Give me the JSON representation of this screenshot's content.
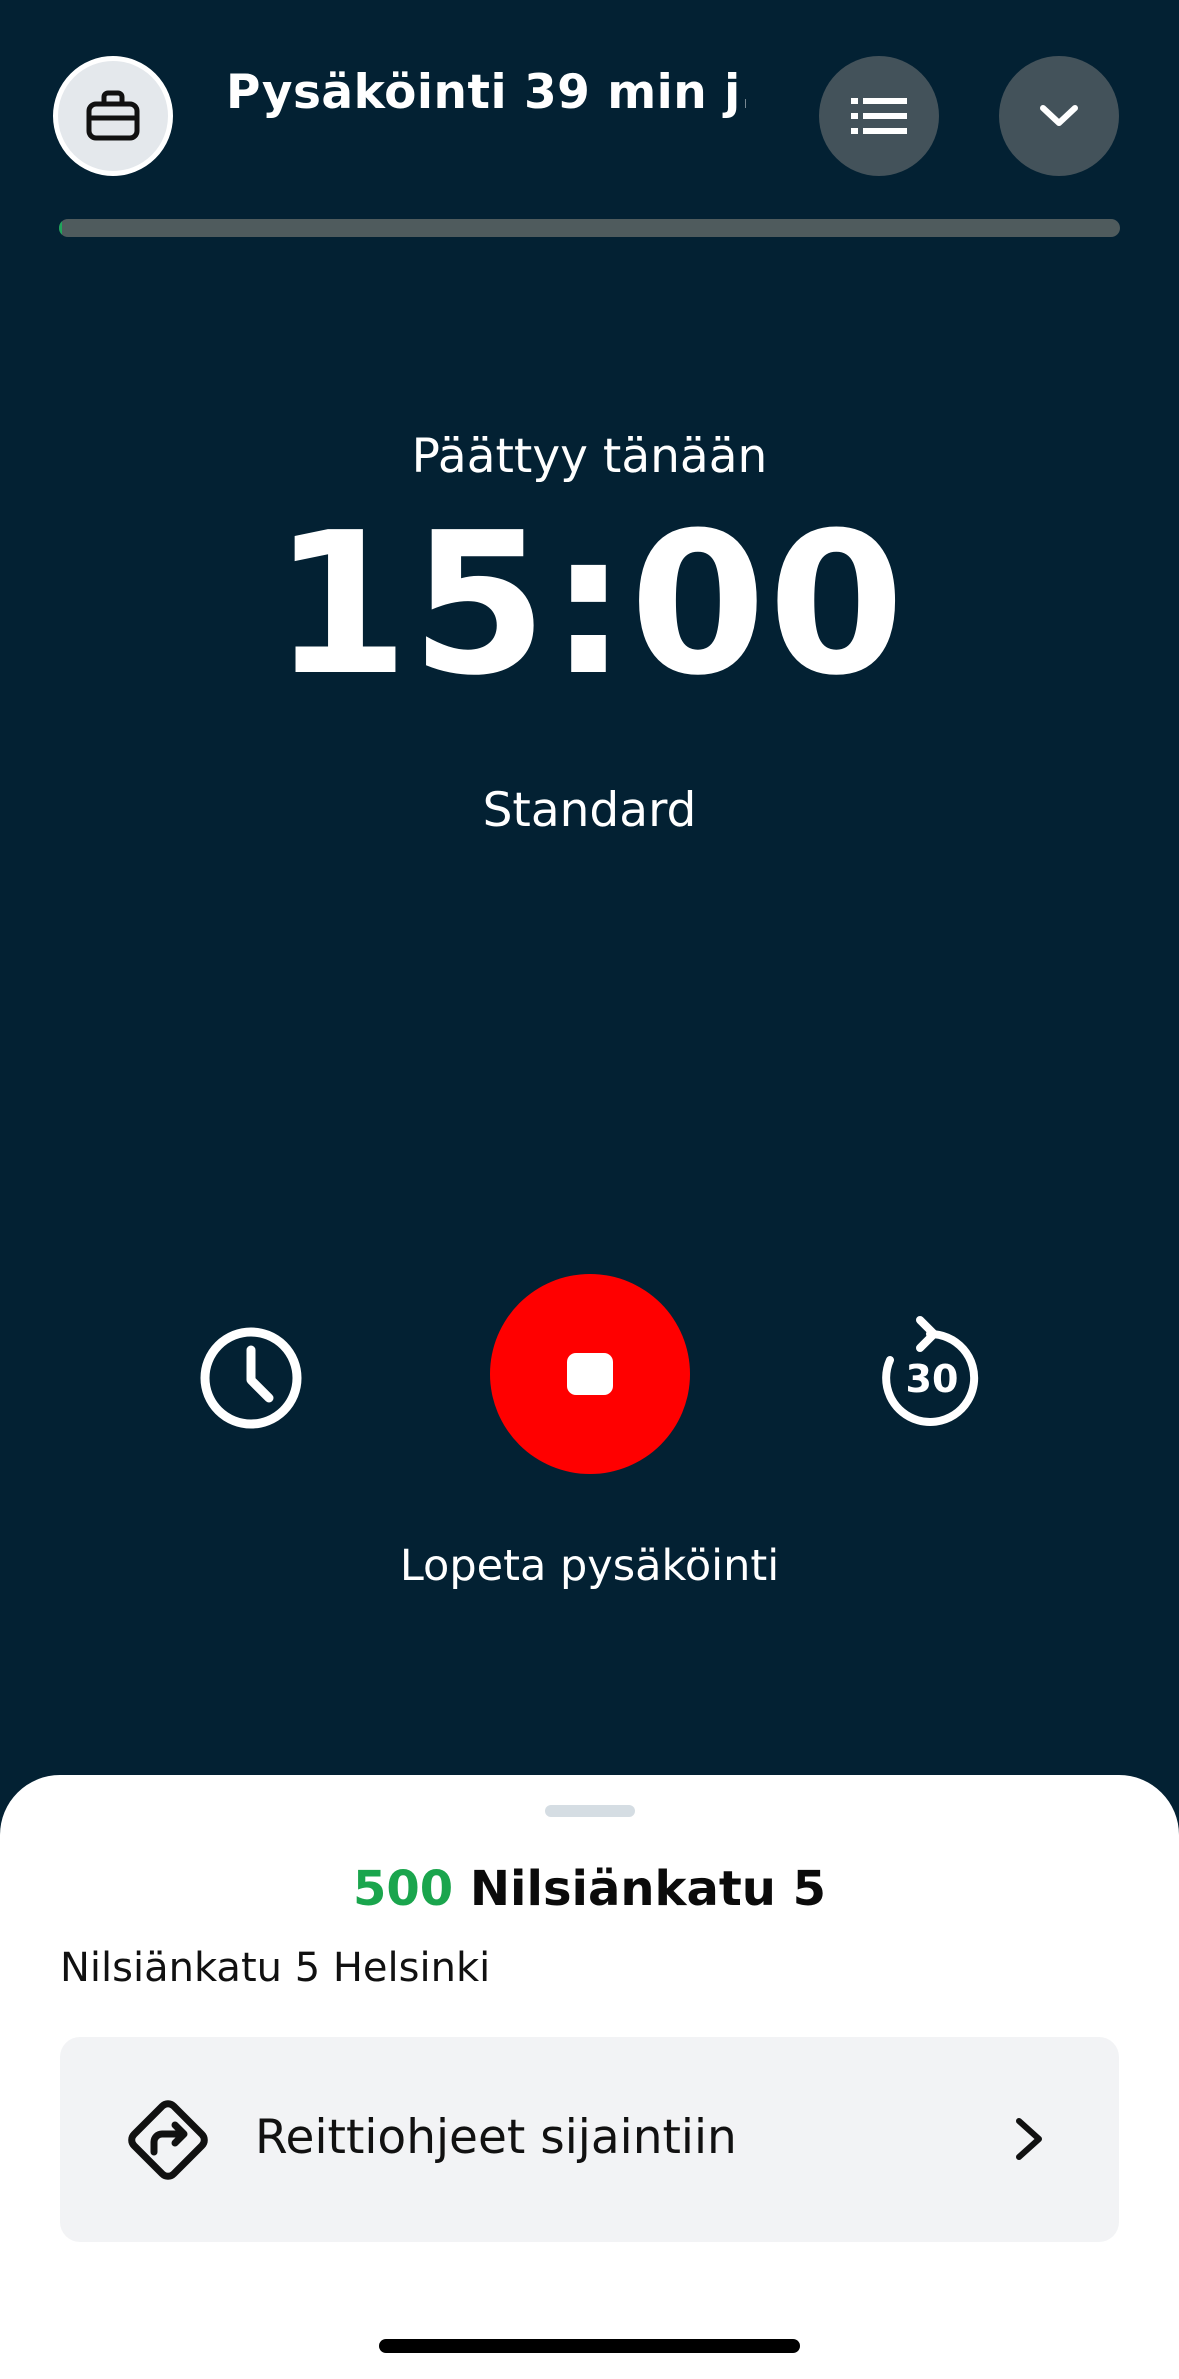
{
  "header": {
    "title": "Pysäköinti 39 min j...",
    "briefcase_icon": "briefcase-icon",
    "list_icon": "list-icon",
    "collapse_icon": "chevron-down-icon"
  },
  "progress": {
    "fraction": 0.003,
    "track_color": "#4f5b5d",
    "fill_color": "#1fa55b"
  },
  "session": {
    "ends_label": "Päättyy tänään",
    "end_time": "15:00",
    "zone_type": "Standard"
  },
  "controls": {
    "clock_icon": "clock-icon",
    "stop_icon": "stop-icon",
    "extend_icon": "rotate-30-icon",
    "extend_label": "30",
    "stop_label": "Lopeta pysäköinti",
    "stop_color": "#ff0000"
  },
  "location": {
    "zone_code": "500",
    "zone_name": "Nilsiänkatu 5",
    "address": "Nilsiänkatu 5 Helsinki",
    "zone_code_color": "#1aa54d"
  },
  "directions": {
    "label": "Reittiohjeet sijaintiin",
    "icon": "directions-icon",
    "chevron_icon": "chevron-right-icon"
  },
  "colors": {
    "background": "#032133",
    "sheet": "#ffffff"
  }
}
